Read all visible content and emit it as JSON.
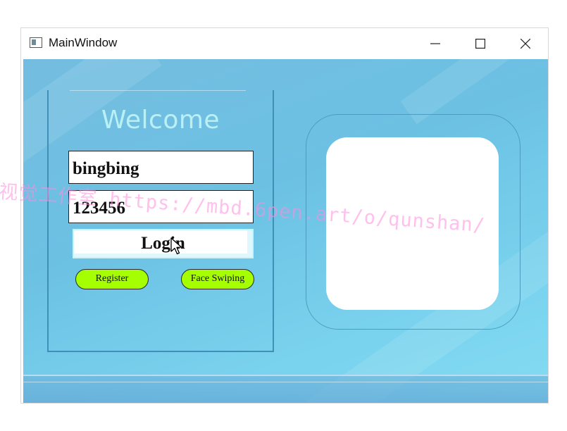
{
  "window": {
    "title": "MainWindow",
    "icon": "app-window-icon",
    "controls": [
      "minimize-icon",
      "maximize-icon",
      "close-icon"
    ]
  },
  "login": {
    "heading": "Welcome",
    "username_value": "bingbing",
    "password_value": "123456",
    "login_label": "Login",
    "register_label": "Register",
    "face_label": "Face Swiping"
  },
  "watermark": {
    "text": "视觉工作室 https://mbd.6pen.art/o/qunshan/"
  },
  "colors": {
    "background": "#74bde0",
    "pill_button": "#a6ff00",
    "welcome_text": "#b9f0f6",
    "frame_border": "#3f8fb8"
  }
}
